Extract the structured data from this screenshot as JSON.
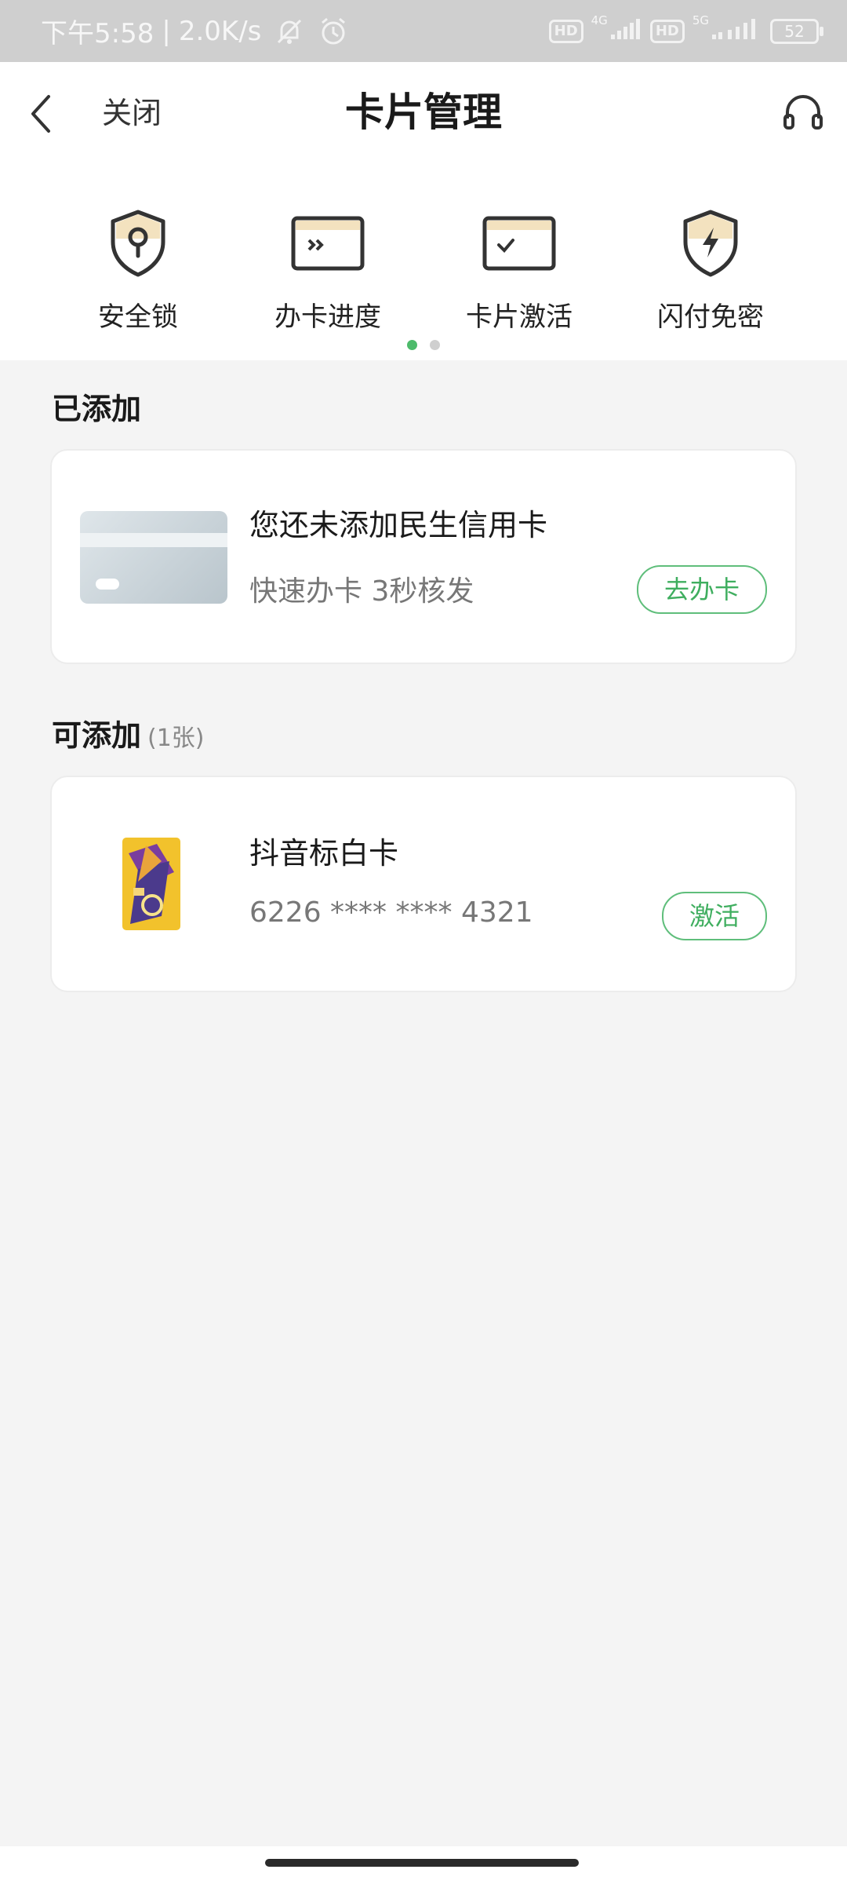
{
  "status_bar": {
    "time": "下午5:58",
    "speed": "2.0K/s",
    "net1": "4G",
    "net2": "5G",
    "hd": "HD",
    "battery": "52"
  },
  "header": {
    "close_label": "关闭",
    "title": "卡片管理"
  },
  "quick_menu": [
    {
      "label": "安全锁",
      "icon": "shield-lock-icon"
    },
    {
      "label": "办卡进度",
      "icon": "card-progress-icon"
    },
    {
      "label": "卡片激活",
      "icon": "card-activate-icon"
    },
    {
      "label": "闪付免密",
      "icon": "shield-flash-icon"
    }
  ],
  "added": {
    "section_title": "已添加",
    "card_title": "您还未添加民生信用卡",
    "card_subtitle": "快速办卡 3秒核发",
    "button_label": "去办卡"
  },
  "available": {
    "section_title": "可添加",
    "count": "(1张)",
    "card_title": "抖音标白卡",
    "card_number": "6226 **** **** 4321",
    "button_label": "激活"
  },
  "colors": {
    "accent_green": "#3fae5f",
    "background": "#f4f4f4"
  }
}
